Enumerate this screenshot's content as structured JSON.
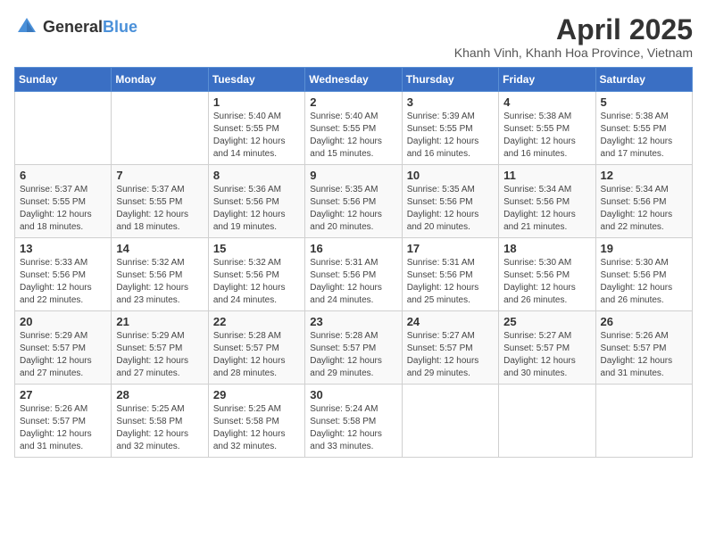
{
  "header": {
    "logo_general": "General",
    "logo_blue": "Blue",
    "title": "April 2025",
    "location": "Khanh Vinh, Khanh Hoa Province, Vietnam"
  },
  "days_of_week": [
    "Sunday",
    "Monday",
    "Tuesday",
    "Wednesday",
    "Thursday",
    "Friday",
    "Saturday"
  ],
  "weeks": [
    {
      "days": [
        {
          "number": "",
          "detail": ""
        },
        {
          "number": "",
          "detail": ""
        },
        {
          "number": "1",
          "detail": "Sunrise: 5:40 AM\nSunset: 5:55 PM\nDaylight: 12 hours and 14 minutes."
        },
        {
          "number": "2",
          "detail": "Sunrise: 5:40 AM\nSunset: 5:55 PM\nDaylight: 12 hours and 15 minutes."
        },
        {
          "number": "3",
          "detail": "Sunrise: 5:39 AM\nSunset: 5:55 PM\nDaylight: 12 hours and 16 minutes."
        },
        {
          "number": "4",
          "detail": "Sunrise: 5:38 AM\nSunset: 5:55 PM\nDaylight: 12 hours and 16 minutes."
        },
        {
          "number": "5",
          "detail": "Sunrise: 5:38 AM\nSunset: 5:55 PM\nDaylight: 12 hours and 17 minutes."
        }
      ]
    },
    {
      "days": [
        {
          "number": "6",
          "detail": "Sunrise: 5:37 AM\nSunset: 5:55 PM\nDaylight: 12 hours and 18 minutes."
        },
        {
          "number": "7",
          "detail": "Sunrise: 5:37 AM\nSunset: 5:55 PM\nDaylight: 12 hours and 18 minutes."
        },
        {
          "number": "8",
          "detail": "Sunrise: 5:36 AM\nSunset: 5:56 PM\nDaylight: 12 hours and 19 minutes."
        },
        {
          "number": "9",
          "detail": "Sunrise: 5:35 AM\nSunset: 5:56 PM\nDaylight: 12 hours and 20 minutes."
        },
        {
          "number": "10",
          "detail": "Sunrise: 5:35 AM\nSunset: 5:56 PM\nDaylight: 12 hours and 20 minutes."
        },
        {
          "number": "11",
          "detail": "Sunrise: 5:34 AM\nSunset: 5:56 PM\nDaylight: 12 hours and 21 minutes."
        },
        {
          "number": "12",
          "detail": "Sunrise: 5:34 AM\nSunset: 5:56 PM\nDaylight: 12 hours and 22 minutes."
        }
      ]
    },
    {
      "days": [
        {
          "number": "13",
          "detail": "Sunrise: 5:33 AM\nSunset: 5:56 PM\nDaylight: 12 hours and 22 minutes."
        },
        {
          "number": "14",
          "detail": "Sunrise: 5:32 AM\nSunset: 5:56 PM\nDaylight: 12 hours and 23 minutes."
        },
        {
          "number": "15",
          "detail": "Sunrise: 5:32 AM\nSunset: 5:56 PM\nDaylight: 12 hours and 24 minutes."
        },
        {
          "number": "16",
          "detail": "Sunrise: 5:31 AM\nSunset: 5:56 PM\nDaylight: 12 hours and 24 minutes."
        },
        {
          "number": "17",
          "detail": "Sunrise: 5:31 AM\nSunset: 5:56 PM\nDaylight: 12 hours and 25 minutes."
        },
        {
          "number": "18",
          "detail": "Sunrise: 5:30 AM\nSunset: 5:56 PM\nDaylight: 12 hours and 26 minutes."
        },
        {
          "number": "19",
          "detail": "Sunrise: 5:30 AM\nSunset: 5:56 PM\nDaylight: 12 hours and 26 minutes."
        }
      ]
    },
    {
      "days": [
        {
          "number": "20",
          "detail": "Sunrise: 5:29 AM\nSunset: 5:57 PM\nDaylight: 12 hours and 27 minutes."
        },
        {
          "number": "21",
          "detail": "Sunrise: 5:29 AM\nSunset: 5:57 PM\nDaylight: 12 hours and 27 minutes."
        },
        {
          "number": "22",
          "detail": "Sunrise: 5:28 AM\nSunset: 5:57 PM\nDaylight: 12 hours and 28 minutes."
        },
        {
          "number": "23",
          "detail": "Sunrise: 5:28 AM\nSunset: 5:57 PM\nDaylight: 12 hours and 29 minutes."
        },
        {
          "number": "24",
          "detail": "Sunrise: 5:27 AM\nSunset: 5:57 PM\nDaylight: 12 hours and 29 minutes."
        },
        {
          "number": "25",
          "detail": "Sunrise: 5:27 AM\nSunset: 5:57 PM\nDaylight: 12 hours and 30 minutes."
        },
        {
          "number": "26",
          "detail": "Sunrise: 5:26 AM\nSunset: 5:57 PM\nDaylight: 12 hours and 31 minutes."
        }
      ]
    },
    {
      "days": [
        {
          "number": "27",
          "detail": "Sunrise: 5:26 AM\nSunset: 5:57 PM\nDaylight: 12 hours and 31 minutes."
        },
        {
          "number": "28",
          "detail": "Sunrise: 5:25 AM\nSunset: 5:58 PM\nDaylight: 12 hours and 32 minutes."
        },
        {
          "number": "29",
          "detail": "Sunrise: 5:25 AM\nSunset: 5:58 PM\nDaylight: 12 hours and 32 minutes."
        },
        {
          "number": "30",
          "detail": "Sunrise: 5:24 AM\nSunset: 5:58 PM\nDaylight: 12 hours and 33 minutes."
        },
        {
          "number": "",
          "detail": ""
        },
        {
          "number": "",
          "detail": ""
        },
        {
          "number": "",
          "detail": ""
        }
      ]
    }
  ]
}
